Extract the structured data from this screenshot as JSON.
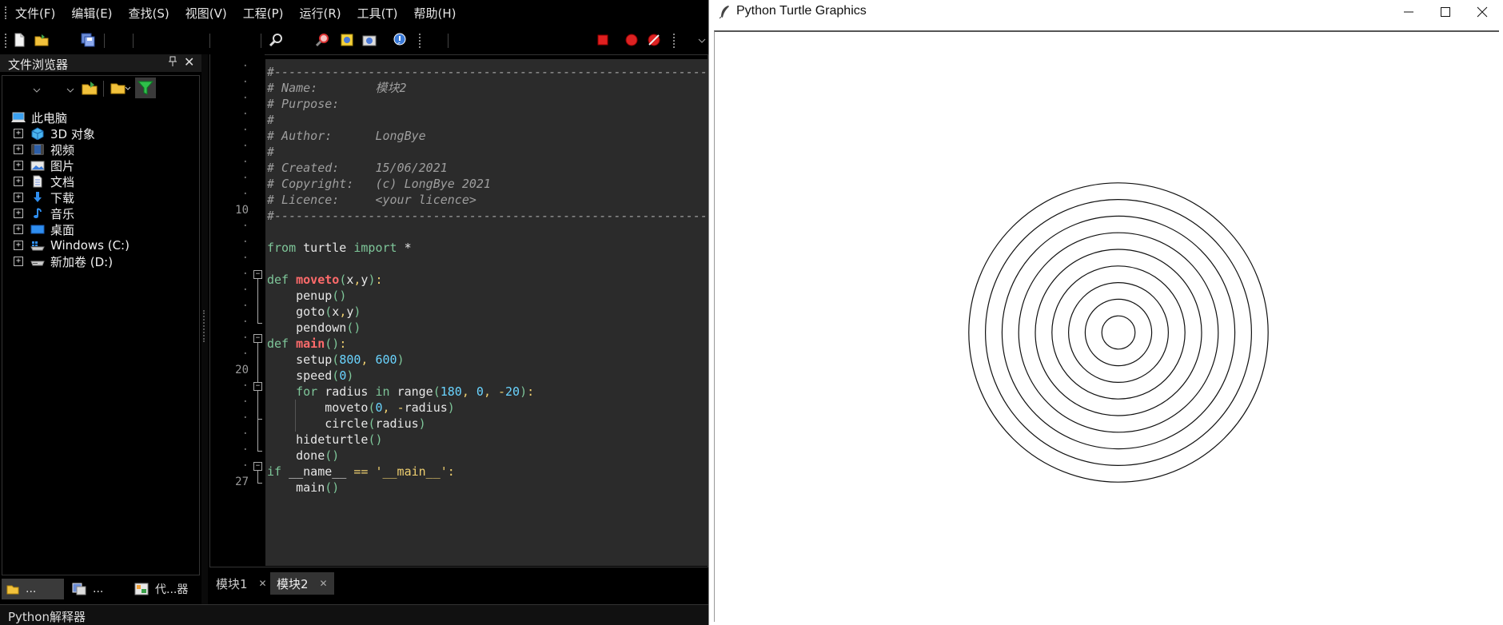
{
  "ide": {
    "menu": [
      "文件(F)",
      "编辑(E)",
      "查找(S)",
      "视图(V)",
      "工程(P)",
      "运行(R)",
      "工具(T)",
      "帮助(H)"
    ],
    "file_browser": {
      "title": "文件浏览器",
      "pin": "ᵖ",
      "close": "✕",
      "root": "此电脑",
      "items": [
        {
          "label": "3D 对象",
          "icon": "3d-objects-icon"
        },
        {
          "label": "视频",
          "icon": "video-icon"
        },
        {
          "label": "图片",
          "icon": "pictures-icon"
        },
        {
          "label": "文档",
          "icon": "documents-icon"
        },
        {
          "label": "下载",
          "icon": "downloads-icon"
        },
        {
          "label": "音乐",
          "icon": "music-icon"
        },
        {
          "label": "桌面",
          "icon": "desktop-icon"
        },
        {
          "label": "Windows (C:)",
          "icon": "windows-drive-icon"
        },
        {
          "label": "新加卷 (D:)",
          "icon": "drive-icon"
        }
      ],
      "expand_symbol": "+",
      "bottom_tabs": [
        "...",
        "...",
        "代...器"
      ]
    },
    "editor": {
      "line_numbers": {
        "10": "10",
        "20": "20",
        "27": "27"
      },
      "lines": [
        "#-------------------------------------------------------------------------------",
        "# Name:        模块2",
        "# Purpose:",
        "#",
        "# Author:      LongBye",
        "#",
        "# Created:     15/06/2021",
        "# Copyright:   (c) LongBye 2021",
        "# Licence:     <your licence>",
        "#-------------------------------------------------------------------------------",
        "",
        "from turtle import *",
        "",
        "def moveto(x,y):",
        "    penup()",
        "    goto(x,y)",
        "    pendown()",
        "def main():",
        "    setup(800, 600)",
        "    speed(0)",
        "    for radius in range(180, 0, -20):",
        "        moveto(0, -radius)",
        "        circle(radius)",
        "    hideturtle()",
        "    done()",
        "if __name__ == '__main__':",
        "    main()"
      ],
      "tabs": [
        {
          "label": "模块1",
          "close": "✕",
          "active": false
        },
        {
          "label": "模块2",
          "close": "✕",
          "active": true
        }
      ]
    },
    "status": "Python解释器",
    "colors": {
      "comment": "#9e9e9e",
      "keyword": "#7ec699",
      "function_name": "#ff6b6b",
      "number": "#6ad4ff",
      "string": "#f0d070",
      "code_bg": "#2b2b2b"
    }
  },
  "turtle_window": {
    "title": "Python Turtle Graphics",
    "controls": [
      "minimize-icon",
      "maximize-icon",
      "close-icon"
    ],
    "radii": [
      180,
      160,
      140,
      120,
      100,
      80,
      60,
      40,
      20
    ]
  }
}
